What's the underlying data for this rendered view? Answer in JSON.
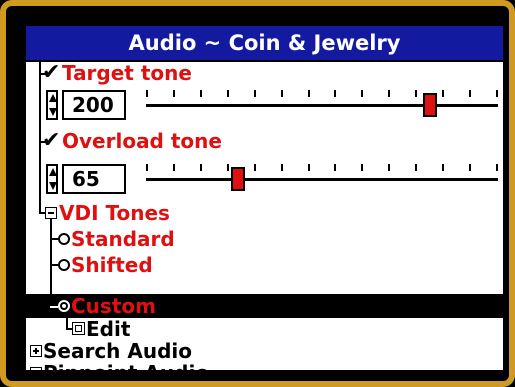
{
  "window": {
    "title": "Audio ~ Coin & Jewelry"
  },
  "target_tone": {
    "label": "Target tone",
    "checked": true,
    "value": "200",
    "level": 0.82
  },
  "overload_tone": {
    "label": "Overload tone",
    "checked": true,
    "value": "65",
    "level": 0.25
  },
  "vdi_tones": {
    "label": "VDI Tones",
    "options": [
      {
        "label": "Standard",
        "selected": false
      },
      {
        "label": "Shifted",
        "selected": false
      },
      {
        "label": "Custom",
        "selected": true
      }
    ],
    "edit_label": "Edit"
  },
  "search_audio": {
    "label": "Search Audio",
    "expanded": false
  },
  "pinpoint_audio": {
    "label": "Pinpoint Audio",
    "expanded": false
  },
  "colors": {
    "title_bg": "#141aa0",
    "accent_red": "#e01010",
    "bezel": "#d09a22",
    "highlight": "#000000"
  }
}
